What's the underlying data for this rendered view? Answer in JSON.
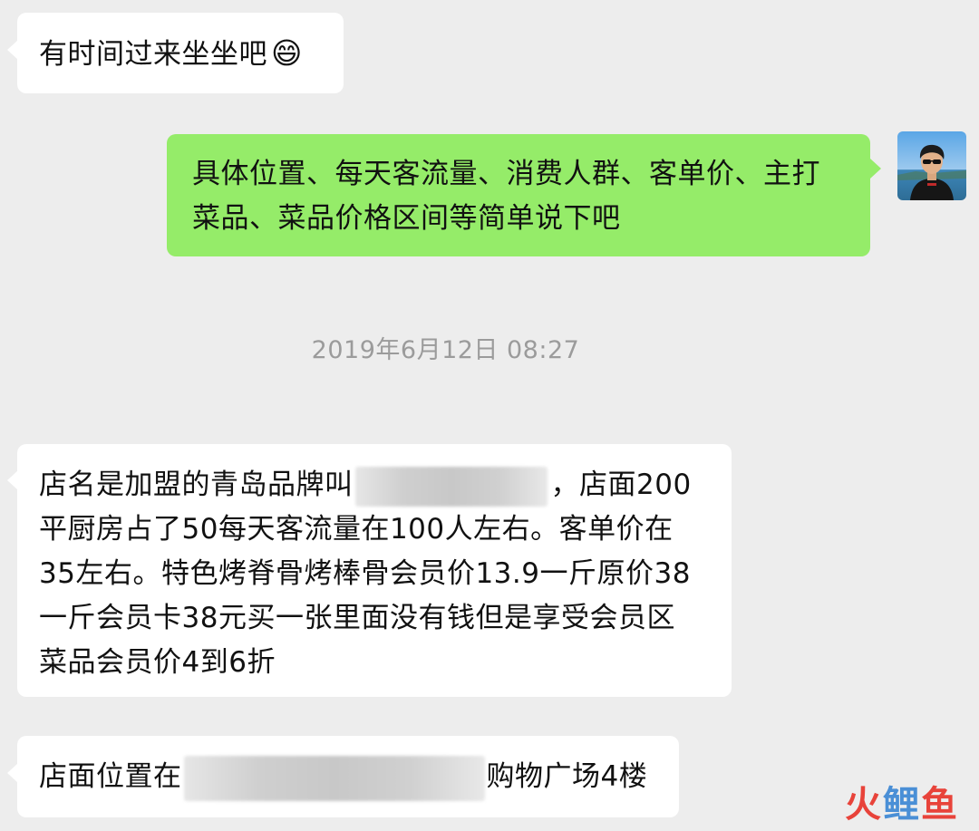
{
  "messages": [
    {
      "text": "有时间过来坐坐吧",
      "emoji": "😄"
    },
    {
      "line1": "具体位置、每天客流量、消费人群、客单价、主打",
      "line2": "菜品、菜品价格区间等简单说下吧"
    },
    {
      "line1_prefix": "店名是加盟的青岛品牌叫",
      "line1_suffix": "，店面200",
      "line2": "平厨房占了50每天客流量在100人左右。客单价在",
      "line3": "35左右。特色烤脊骨烤棒骨会员价13.9一斤原价38",
      "line4": "一斤会员卡38元买一张里面没有钱但是享受会员区",
      "line5": "菜品会员价4到6折"
    },
    {
      "prefix": "店面位置在",
      "suffix": "购物广场4楼"
    }
  ],
  "timestamp": "2019年6月12日 08:27",
  "watermark": {
    "char1": "火",
    "char2": "鲤",
    "char3": "鱼"
  },
  "colors": {
    "background": "#ededed",
    "incoming_bubble": "#ffffff",
    "outgoing_bubble": "#95ec69",
    "timestamp": "#9b9b9b",
    "watermark_red": "#e8433a",
    "watermark_blue": "#4a8fd6"
  }
}
